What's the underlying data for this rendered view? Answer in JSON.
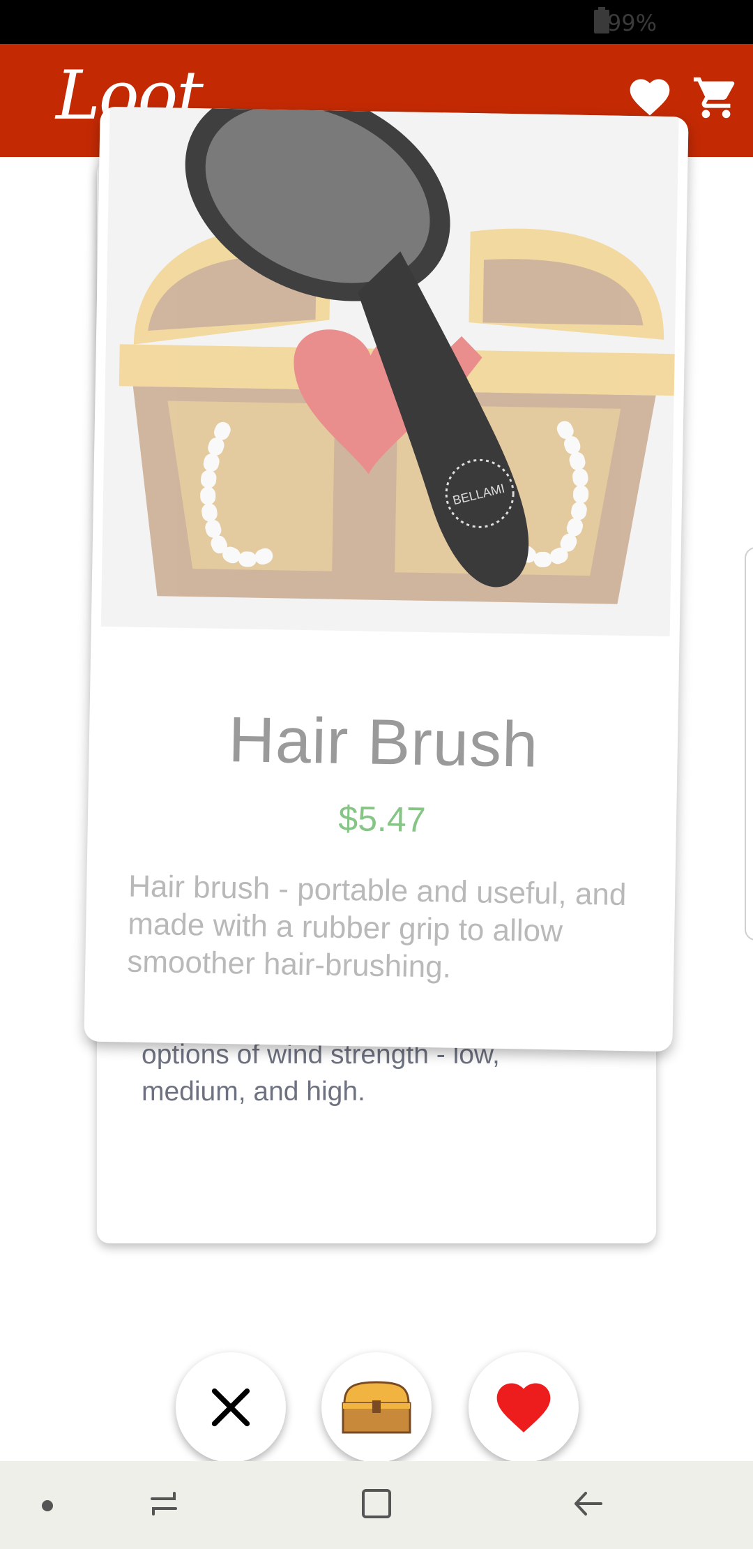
{
  "status_bar": {
    "battery": "99%"
  },
  "app_bar": {
    "logo_text": "Loot",
    "icons": [
      "heart-icon",
      "cart-icon"
    ],
    "color": "#c32a04"
  },
  "front_card": {
    "title": "Hair Brush",
    "price": "$5.47",
    "description": "Hair brush - portable and useful, and made with a rubber grip to allow smoother hair-brushing.",
    "image_text": "BELLAMI",
    "price_color": "#86c586"
  },
  "back_card": {
    "description": "options of wind strength - low, medium, and high."
  },
  "actions": {
    "dislike": "close-icon",
    "chest": "treasure-chest-icon",
    "like": "heart-icon",
    "like_color": "#ee1d1d"
  },
  "nav_bar": {
    "items": [
      "dot",
      "recents-icon",
      "home-icon",
      "back-icon"
    ]
  }
}
